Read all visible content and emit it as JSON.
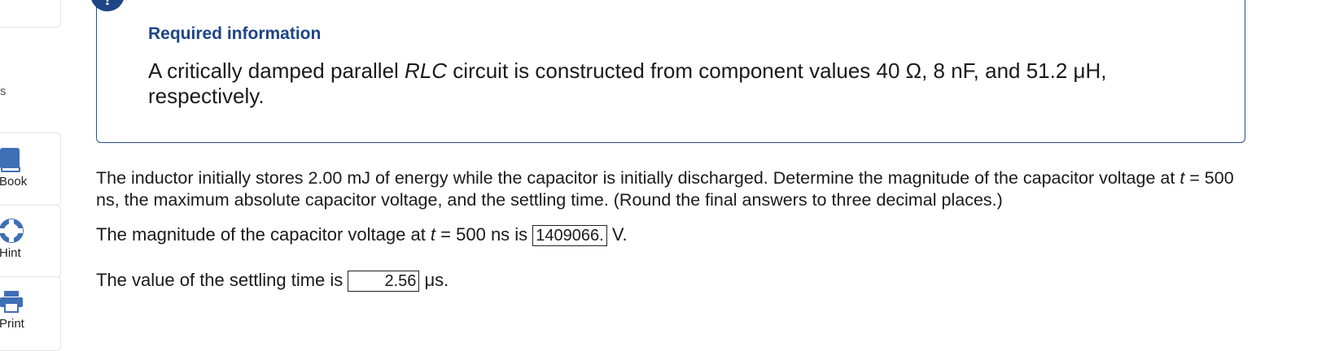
{
  "sidebar": {
    "partial_label": "s",
    "tools": [
      {
        "id": "ebook",
        "label": "Book",
        "icon": "book-icon"
      },
      {
        "id": "hint",
        "label": "Hint",
        "icon": "lifebuoy-icon"
      },
      {
        "id": "print",
        "label": "Print",
        "icon": "printer-icon"
      }
    ]
  },
  "info": {
    "badge": "!",
    "heading": "Required information",
    "text_before": "A critically damped parallel ",
    "text_var": "RLC",
    "text_after": " circuit is constructed from component values 40 Ω, 8 nF, and 51.2 μH, respectively."
  },
  "question": {
    "part1": "The inductor initially stores 2.00 mJ of energy while the capacitor is initially discharged. Determine the magnitude of the capacitor voltage at ",
    "var": "t",
    "part2": " = 500 ns, the maximum absolute capacitor voltage, and the settling time. (Round the final answers to three decimal places.)"
  },
  "answers": [
    {
      "prefix": "The magnitude of the capacitor voltage at ",
      "var": "t",
      "mid": " = 500 ns is ",
      "value": "1409066.",
      "unit": "V."
    },
    {
      "prefix": "The value of the settling time is ",
      "var": "",
      "mid": "",
      "value": "2.56",
      "unit": "μs."
    }
  ],
  "colors": {
    "accent": "#1e4585",
    "icon_blue": "#3f6fb5"
  }
}
